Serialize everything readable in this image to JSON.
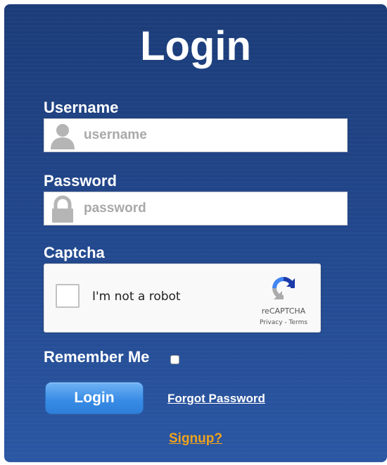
{
  "title": "Login",
  "username": {
    "label": "Username",
    "placeholder": "username",
    "value": "",
    "icon": "user-icon"
  },
  "password": {
    "label": "Password",
    "placeholder": "password",
    "value": "",
    "icon": "lock-icon"
  },
  "captcha": {
    "label": "Captcha",
    "checkbox_text": "I'm not a robot",
    "brand": "reCAPTCHA",
    "privacy": "Privacy",
    "separator": " - ",
    "terms": "Terms",
    "icon": "recaptcha-logo-icon"
  },
  "remember": {
    "label": "Remember Me",
    "checked": false
  },
  "actions": {
    "login_label": "Login",
    "forgot_label": "Forgot Password",
    "signup_label": "Signup?"
  },
  "colors": {
    "panel_top": "#1b3c78",
    "panel_bottom": "#2a56a3",
    "button": "#3a8de6",
    "signup": "#f0a31c",
    "icon_gray": "#b5b5b5"
  }
}
